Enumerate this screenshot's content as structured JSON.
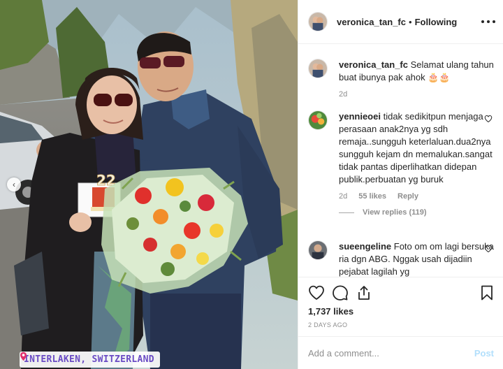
{
  "post": {
    "username": "veronica_tan_fc",
    "dot": "•",
    "follow_status": "Following",
    "location": "INTERLAKEN, SWITZERLAND",
    "cake_number": "22"
  },
  "comments": [
    {
      "username": "veronica_tan_fc",
      "text": "Selamat ulang tahun buat ibunya pak ahok",
      "emoji": "🎂🎂",
      "age": "2d"
    },
    {
      "username": "yennieoei",
      "text": "tidak sedikitpun menjaga perasaan anak2nya yg sdh remaja..sungguh keterlaluan.dua2nya sungguh kejam dn memalukan.sangat tidak pantas diperlihatkan didepan publik.perbuatan yg buruk",
      "age": "2d",
      "likes": "55 likes",
      "reply_label": "Reply",
      "view_replies": "View replies (119)"
    },
    {
      "username": "sueengeline",
      "text": "Foto om om lagi bersuka ria dgn ABG. Nggak usah dijadiin pejabat lagilah yg"
    }
  ],
  "stats": {
    "likes": "1,737 likes",
    "posted": "2 DAYS AGO"
  },
  "composer": {
    "placeholder": "Add a comment...",
    "post_label": "Post"
  },
  "colors": {
    "location_text": "#6a4bc4",
    "post_button": "#b2dffc",
    "muted_text": "#8e8e8e"
  },
  "icons": [
    "more-options-icon",
    "heart-icon",
    "comment-icon",
    "share-icon",
    "bookmark-icon",
    "location-pin-icon",
    "chevron-left-icon"
  ]
}
